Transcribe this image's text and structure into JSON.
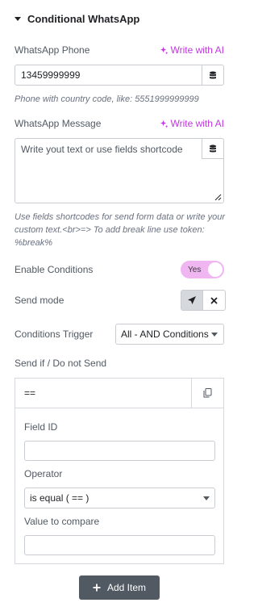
{
  "section": {
    "title": "Conditional WhatsApp"
  },
  "phone": {
    "label": "WhatsApp Phone",
    "ai_label": "Write with AI",
    "value": "13459999999",
    "help": "Phone with country code, like: 5551999999999"
  },
  "message": {
    "label": "WhatsApp Message",
    "ai_label": "Write with AI",
    "placeholder": "Write yout text or use fields shortcode",
    "help": "Use fields shortcodes for send form data or write your custom text.<br>=> To add break line use token: %break%"
  },
  "enable_conditions": {
    "label": "Enable Conditions",
    "toggle_text": "Yes",
    "on": true
  },
  "send_mode": {
    "label": "Send mode",
    "options": [
      "send-icon",
      "close-icon"
    ],
    "selected": "send-icon"
  },
  "trigger": {
    "label": "Conditions Trigger",
    "value": "All - AND Conditions"
  },
  "send_if": {
    "label": "Send if / Do not Send"
  },
  "repeater": {
    "item_title": "==",
    "field_id_label": "Field ID",
    "field_id_value": "",
    "operator_label": "Operator",
    "operator_value": "is equal ( == )",
    "compare_label": "Value to compare",
    "compare_value": ""
  },
  "add_item": {
    "label": "Add Item"
  },
  "colors": {
    "accent": "#c036e0",
    "toggle_bg": "#efb6f1",
    "button_bg": "#515962"
  }
}
